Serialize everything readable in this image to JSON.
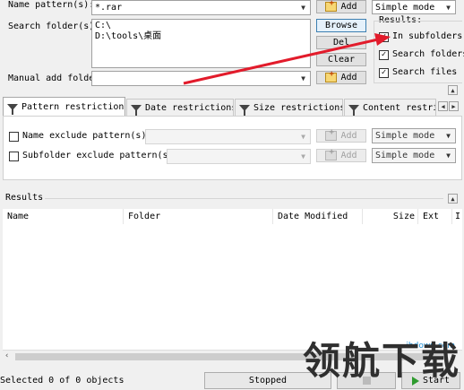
{
  "top": {
    "name_pattern_label": "Name pattern(s):",
    "name_pattern_value": "*.rar",
    "search_folder_label": "Search folder(s):",
    "search_folder_lines": [
      "C:\\",
      "D:\\tools\\桌面"
    ],
    "manual_add_label": "Manual add folder",
    "add_label": "Add",
    "browse_label": "Browse",
    "del_label": "Del",
    "clear_label": "Clear",
    "mode_selected": "Simple mode"
  },
  "results_options": {
    "title": "Results:",
    "in_subfolders": "In subfolders",
    "search_folders": "Search folders",
    "search_files": "Search files"
  },
  "tabs": [
    {
      "label": "Pattern restrictions"
    },
    {
      "label": "Date restrictions"
    },
    {
      "label": "Size restrictions"
    },
    {
      "label": "Content restrictions"
    }
  ],
  "pattern_tab": {
    "name_exclude_label": "Name exclude pattern(s):",
    "subfolder_exclude_label": "Subfolder exclude pattern(s):",
    "add_label": "Add",
    "mode_selected": "Simple mode"
  },
  "results": {
    "section_label": "Results",
    "columns": [
      "Name",
      "Folder",
      "Date Modified",
      "Size",
      "Ext",
      "I"
    ]
  },
  "status": {
    "selection_text": "Selected 0 of 0 objects",
    "state_text": "Stopped",
    "start_label": "Start"
  },
  "watermark": {
    "text": "领航下载",
    "url": "ihdown.com"
  },
  "colors": {
    "arrow": "#e21b2b",
    "focus_border": "#3c7fb1",
    "tab_active_bg": "#ffffff"
  }
}
